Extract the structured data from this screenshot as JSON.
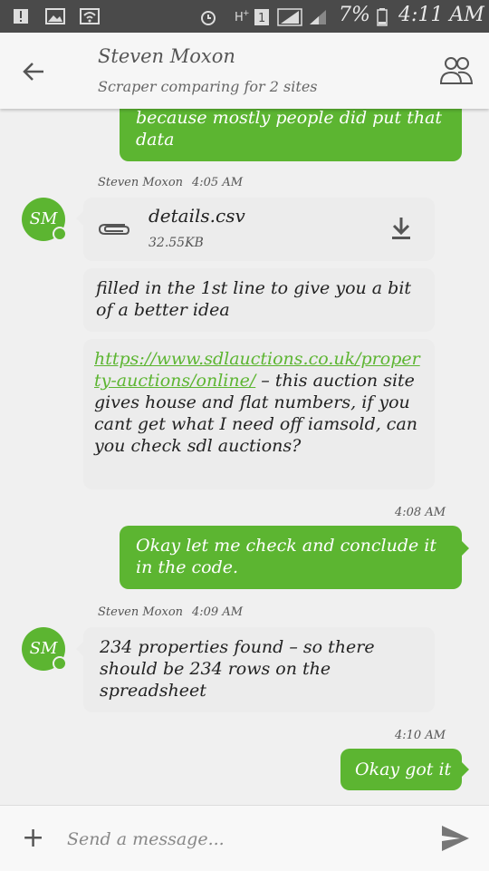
{
  "status_bar": {
    "battery_percent": "7%",
    "time": "4:11 AM",
    "icons": [
      "alert-icon",
      "image-icon",
      "wifi-icon",
      "alarm-icon",
      "h-plus-icon",
      "sim-1-icon",
      "signal-icon",
      "signal-2-icon",
      "battery-icon"
    ]
  },
  "header": {
    "name": "Steven Moxon",
    "subtitle": "Scraper comparing for 2 sites"
  },
  "messages": {
    "m0": {
      "text": "because mostly people did put that data"
    },
    "g1": {
      "sender": "Steven Moxon",
      "time": "4:05 AM",
      "avatar": "SM"
    },
    "file": {
      "name": "details.csv",
      "size": "32.55KB"
    },
    "m2": {
      "text": "filled in the 1st line to give you a bit of a better idea"
    },
    "m3": {
      "link": "https://www.sdlauctions.co.uk/property-auctions/online/",
      "text": " – this auction site gives house and flat numbers, if you cant get what I need off iamsold, can you check sdl auctions?"
    },
    "t4": {
      "time": "4:08 AM"
    },
    "m4": {
      "text": "Okay let me check and conclude it in the code."
    },
    "g2": {
      "sender": "Steven Moxon",
      "time": "4:09 AM",
      "avatar": "SM"
    },
    "m5": {
      "text": "234 properties found – so there should be 234 rows on the spreadsheet"
    },
    "t6": {
      "time": "4:10 AM"
    },
    "m6": {
      "text": "Okay got it"
    }
  },
  "composer": {
    "placeholder": "Send a message..."
  },
  "colors": {
    "accent": "#5cb531",
    "incoming_bubble": "#ececec",
    "status_bar": "#4a4a4a"
  }
}
